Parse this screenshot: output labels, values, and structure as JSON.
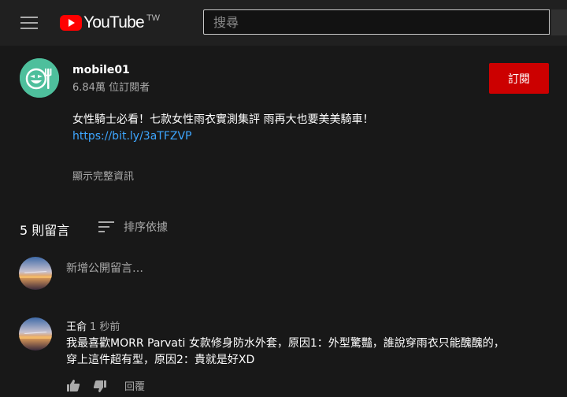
{
  "header": {
    "logo_text": "YouTube",
    "logo_region": "TW",
    "search_placeholder": "搜尋"
  },
  "channel": {
    "name": "mobile01",
    "subscribers": "6.84萬 位訂閱者",
    "subscribe_label": "訂閱",
    "avatar_color": "#4ebf9c"
  },
  "description": {
    "text": "女性騎士必看！七款女性雨衣實測集評 雨再大也要美美騎車！",
    "link": "https://bit.ly/3aTFZVP",
    "show_more": "顯示完整資訊"
  },
  "comments": {
    "count_label": "5 則留言",
    "sort_label": "排序依據",
    "add_placeholder": "新增公開留言…",
    "items": [
      {
        "author": "王俞",
        "time": "1 秒前",
        "line1": "我最喜歡MORR Parvati 女款修身防水外套，原因1：外型驚豔，誰說穿雨衣只能醜醜的，",
        "line2": "穿上這件超有型，原因2：貴就是好XD",
        "reply_label": "回覆"
      }
    ]
  },
  "colors": {
    "background": "#181818",
    "topbar": "#202020",
    "subscribe": "#cc0000",
    "link": "#3ea6ff",
    "secondary_text": "#aaaaaa"
  }
}
